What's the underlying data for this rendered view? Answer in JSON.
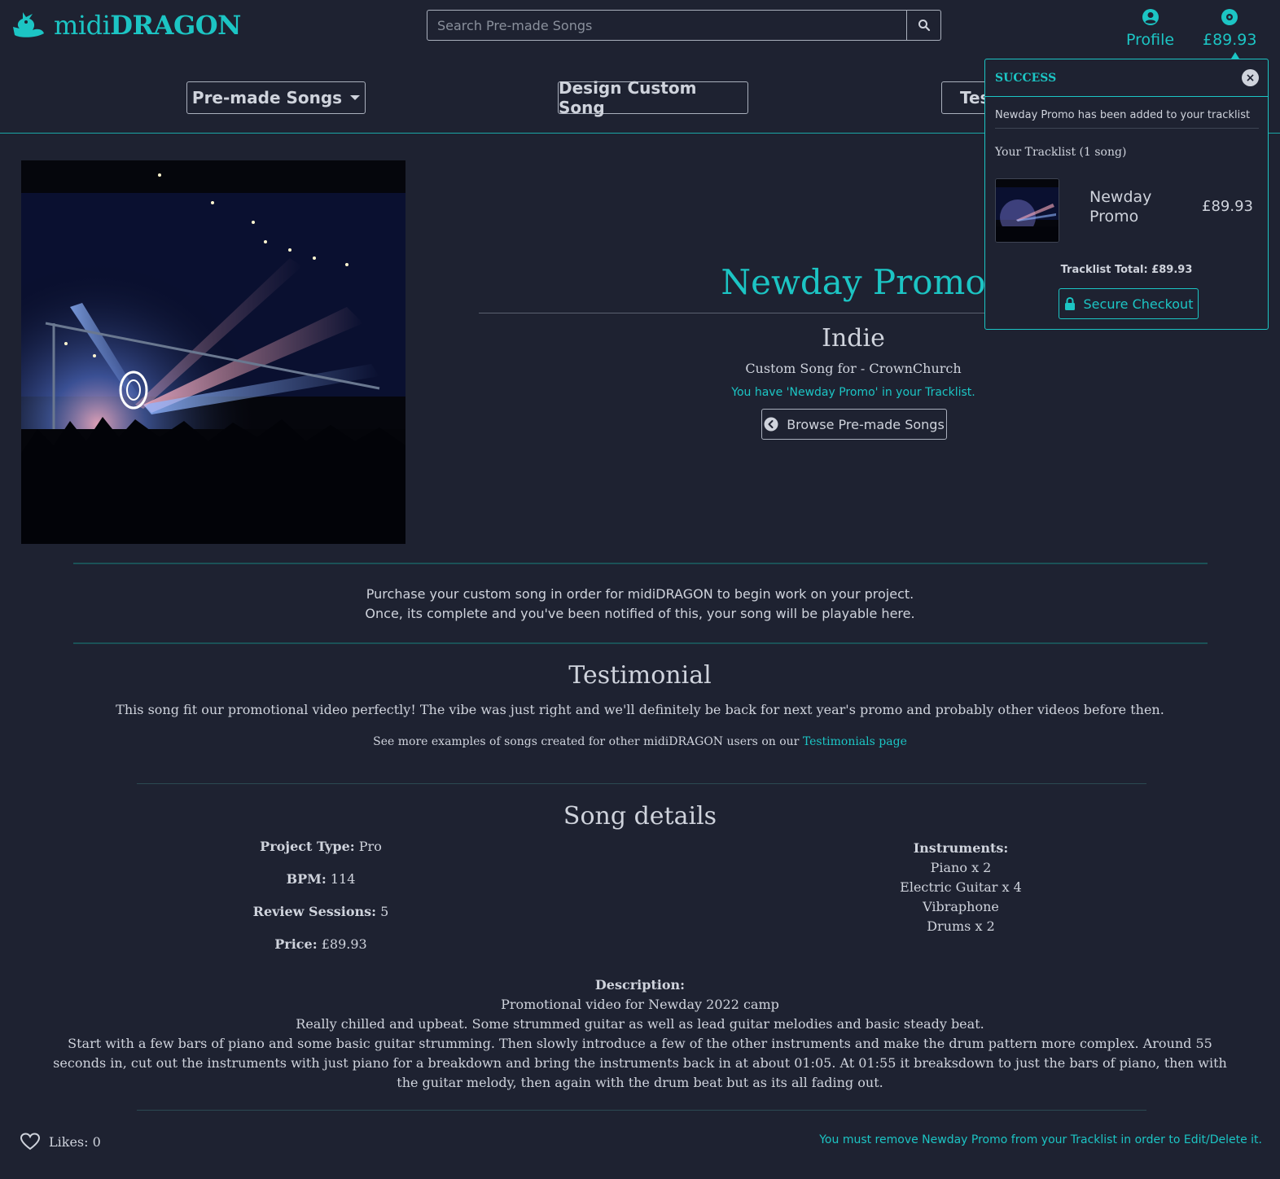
{
  "brand": {
    "name_light": "midi",
    "name_bold": "DRAGON"
  },
  "search": {
    "placeholder": "Search Pre-made Songs"
  },
  "nav": {
    "profile_label": "Profile",
    "cart_label": "£89.93",
    "premade_label": "Pre-made Songs",
    "design_label": "Design Custom Song",
    "testimonials_label": "Tes"
  },
  "song": {
    "title": "Newday Promo",
    "genre": "Indie",
    "custom_for": "Custom Song for - CrownChurch",
    "in_tracklist": "You have 'Newday Promo' in your Tracklist.",
    "browse_label": "Browse Pre-made Songs"
  },
  "purchase": {
    "line1": "Purchase your custom song in order for midiDRAGON to begin work on your project.",
    "line2": "Once, its complete and you've been notified of this, your song will be playable here."
  },
  "testimonial": {
    "heading": "Testimonial",
    "text": "This song fit our promotional video perfectly! The vibe was just right and we'll definitely be back for next year's promo and probably other videos before then.",
    "see_more_prefix": "See more examples of songs created for other midiDRAGON users on our ",
    "see_more_link": "Testimonials page"
  },
  "details": {
    "heading": "Song details",
    "project_type_label": "Project Type:",
    "project_type_value": "Pro",
    "bpm_label": "BPM:",
    "bpm_value": "114",
    "review_label": "Review Sessions:",
    "review_value": "5",
    "price_label": "Price:",
    "price_value": "£89.93",
    "instruments_label": "Instruments:",
    "instruments": [
      "Piano x 2",
      "Electric Guitar x 4",
      "Vibraphone",
      "Drums x 2"
    ],
    "description_label": "Description:",
    "description_lines": [
      "Promotional video for Newday 2022 camp",
      "Really chilled and upbeat. Some strummed guitar as well as lead guitar melodies and basic steady beat.",
      "Start with a few bars of piano and some basic guitar strumming. Then slowly introduce a few of the other instruments and make the drum pattern more complex. Around 55 seconds in, cut out the instruments with just piano for a breakdown and bring the instruments back in at about 01:05. At 01:55 it breaksdown to just the bars of piano, then with the guitar melody, then again with the drum beat but as its all fading out."
    ]
  },
  "footer": {
    "likes_label": "Likes: 0",
    "remove_note": "You must remove Newday Promo from your Tracklist in order to Edit/Delete it."
  },
  "popover": {
    "title": "SUCCESS",
    "message": "Newday Promo has been added to your tracklist",
    "tracklist_label": "Your Tracklist (1 song)",
    "item_name": "Newday Promo",
    "item_price": "£89.93",
    "total": "Tracklist Total: £89.93",
    "checkout_label": "Secure Checkout"
  },
  "colors": {
    "background": "#1e2231",
    "accent": "#1cc5c4",
    "text": "#cfd3dc"
  },
  "icons": [
    "dragon-logo-icon",
    "search-icon",
    "user-circle-icon",
    "disc-icon",
    "caret-down-icon",
    "arrow-left-circle-icon",
    "close-icon",
    "lock-icon",
    "heart-icon"
  ]
}
